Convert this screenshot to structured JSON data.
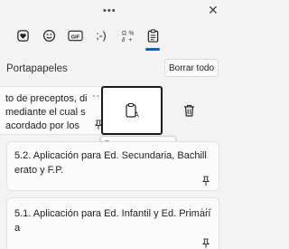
{
  "window": {
    "drag_handle_icon": "more-dots-icon",
    "close_icon": "close-icon"
  },
  "tabs": [
    {
      "name": "emoji-heart",
      "icon": "heart-emoji-icon"
    },
    {
      "name": "emoji",
      "icon": "smiley-icon"
    },
    {
      "name": "gif",
      "icon": "gif-icon",
      "label": "GIF"
    },
    {
      "name": "kaomoji",
      "icon": "kaomoji-icon",
      "label": ";-)"
    },
    {
      "name": "symbols",
      "icon": "symbols-icon"
    },
    {
      "name": "clipboard",
      "icon": "clipboard-icon",
      "active": true
    }
  ],
  "clipboard": {
    "title": "Portapapeles",
    "clear_all_label": "Borrar todo",
    "items": [
      {
        "lines": [
          "to de preceptos, di",
          "mediante el cual s",
          "acordado por los"
        ],
        "more_label": "···"
      },
      {
        "lines": [
          "5.2. Aplicación para Ed. Secundaria, Bachill",
          "erato y F.P."
        ],
        "more_label": "···"
      },
      {
        "lines": [
          "5.1. Aplicación para Ed. Infantil y Ed. Primari",
          "a"
        ],
        "more_label": "···"
      }
    ],
    "paste_as_text_tooltip": "Pegar como texto"
  },
  "colors": {
    "background": "#f3f3f3",
    "card": "#fbfbfb",
    "accent": "#0067c0"
  }
}
